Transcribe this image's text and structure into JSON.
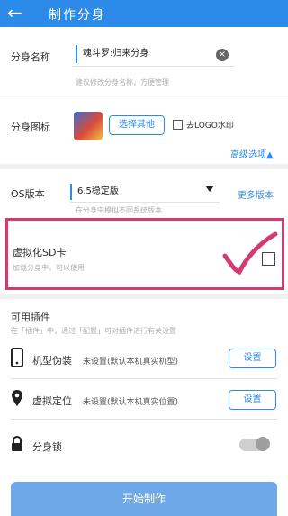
{
  "header": {
    "title": "制作分身",
    "back_icon": "←"
  },
  "clone_name": {
    "label": "分身名称",
    "value": "魂斗罗:归来分身",
    "hint": "建议修改分身名称，方便管理"
  },
  "clone_icon": {
    "label": "分身图标",
    "choose_button": "选择其他",
    "no_logo_label": "去LOGO水印",
    "advanced": "高级选项▲"
  },
  "os": {
    "label": "OS版本",
    "value": "6.5稳定版",
    "more_link": "更多版本",
    "hint": "在分身中模拟不同系统版本"
  },
  "virtual_sd": {
    "label": "虚拟化SD卡",
    "hint": "加载分身中，可以使用"
  },
  "plugins": {
    "title": "可用插件",
    "hint": "在「插件」中，通过「配置」可对插件进行有关设置",
    "items": [
      {
        "icon": "phone-icon",
        "label": "机型伪装",
        "value": "未设置(默认本机真实机型)",
        "button": "设置"
      },
      {
        "icon": "location-icon",
        "label": "虚拟定位",
        "value": "未设置(默认本机真实位置)",
        "button": "设置"
      },
      {
        "icon": "lock-icon",
        "label": "分身锁"
      }
    ]
  },
  "start_button": "开始制作",
  "colors": {
    "primary": "#2c8be8",
    "highlight": "#d43b73",
    "button": "#6fa8e8"
  }
}
